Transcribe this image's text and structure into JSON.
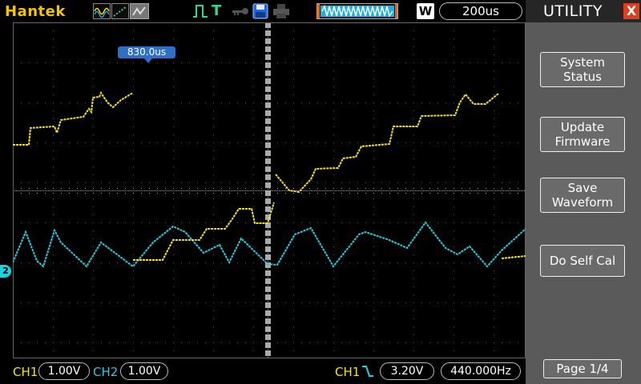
{
  "header": {
    "brand": "Hantek",
    "timebase": "200us",
    "acq_mode_letter": "W",
    "icons": [
      "waveform-mode-icon",
      "dots-mode-icon",
      "grey-mode-icon",
      "pulse-icon",
      "trigger-t-icon",
      "key-icon",
      "disk-icon",
      "printer-icon",
      "buffer-icon"
    ]
  },
  "screen": {
    "trigger_position": "830.0us",
    "ch2_marker": "2"
  },
  "status": {
    "ch1_label": "CH1",
    "ch1_scale": "1.00V",
    "ch2_label": "CH2",
    "ch2_scale": "1.00V",
    "trigger_source": "CH1",
    "trigger_edge": "falling-edge-icon",
    "trigger_level": "3.20V",
    "frequency": "440.000Hz"
  },
  "menu": {
    "title": "UTILITY",
    "close": "X",
    "buttons": [
      {
        "line1": "System",
        "line2": "Status"
      },
      {
        "line1": "Update",
        "line2": "Firmware"
      },
      {
        "line1": "Save",
        "line2": "Waveform"
      },
      {
        "line1": "Do Self Cal",
        "line2": ""
      }
    ],
    "page": "Page 1/4"
  },
  "colors": {
    "ch1": "#f2e21a",
    "ch2": "#1fd0e0",
    "brand": "#f2c500",
    "close": "#e23c1a",
    "menu_bg": "#5a5a5a"
  }
}
